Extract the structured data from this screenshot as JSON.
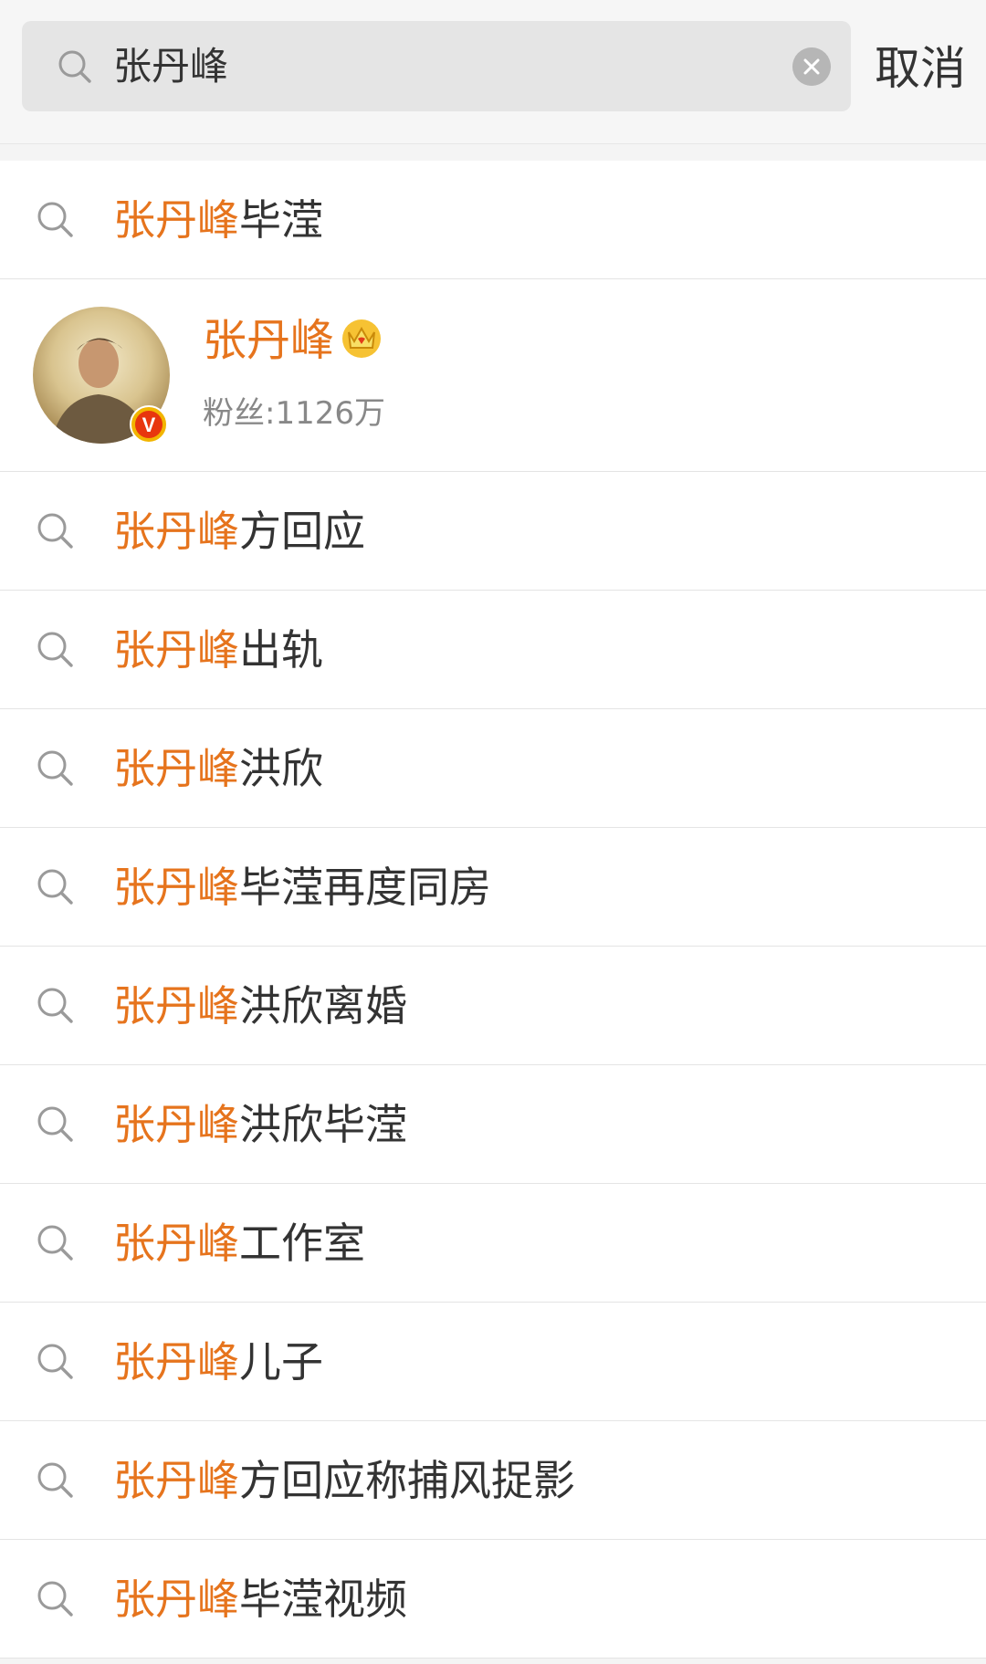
{
  "search": {
    "query": "张丹峰",
    "cancel_label": "取消"
  },
  "suggestions": [
    {
      "highlight": "张丹峰",
      "rest": "毕滢"
    },
    {
      "highlight": "张丹峰",
      "rest": "方回应"
    },
    {
      "highlight": "张丹峰",
      "rest": "出轨"
    },
    {
      "highlight": "张丹峰",
      "rest": "洪欣"
    },
    {
      "highlight": "张丹峰",
      "rest": "毕滢再度同房"
    },
    {
      "highlight": "张丹峰",
      "rest": "洪欣离婚"
    },
    {
      "highlight": "张丹峰",
      "rest": "洪欣毕滢"
    },
    {
      "highlight": "张丹峰",
      "rest": "工作室"
    },
    {
      "highlight": "张丹峰",
      "rest": "儿子"
    },
    {
      "highlight": "张丹峰",
      "rest": "方回应称捕风捉影"
    },
    {
      "highlight": "张丹峰",
      "rest": "毕滢视频"
    }
  ],
  "user": {
    "name": "张丹峰",
    "fans": "粉丝:1126万",
    "verified_badge": "V",
    "avatar_icon": "avatar",
    "crown_icon": "crown-icon"
  },
  "colors": {
    "highlight": "#e6741d",
    "text": "#333333",
    "verified": "#e8a800"
  }
}
